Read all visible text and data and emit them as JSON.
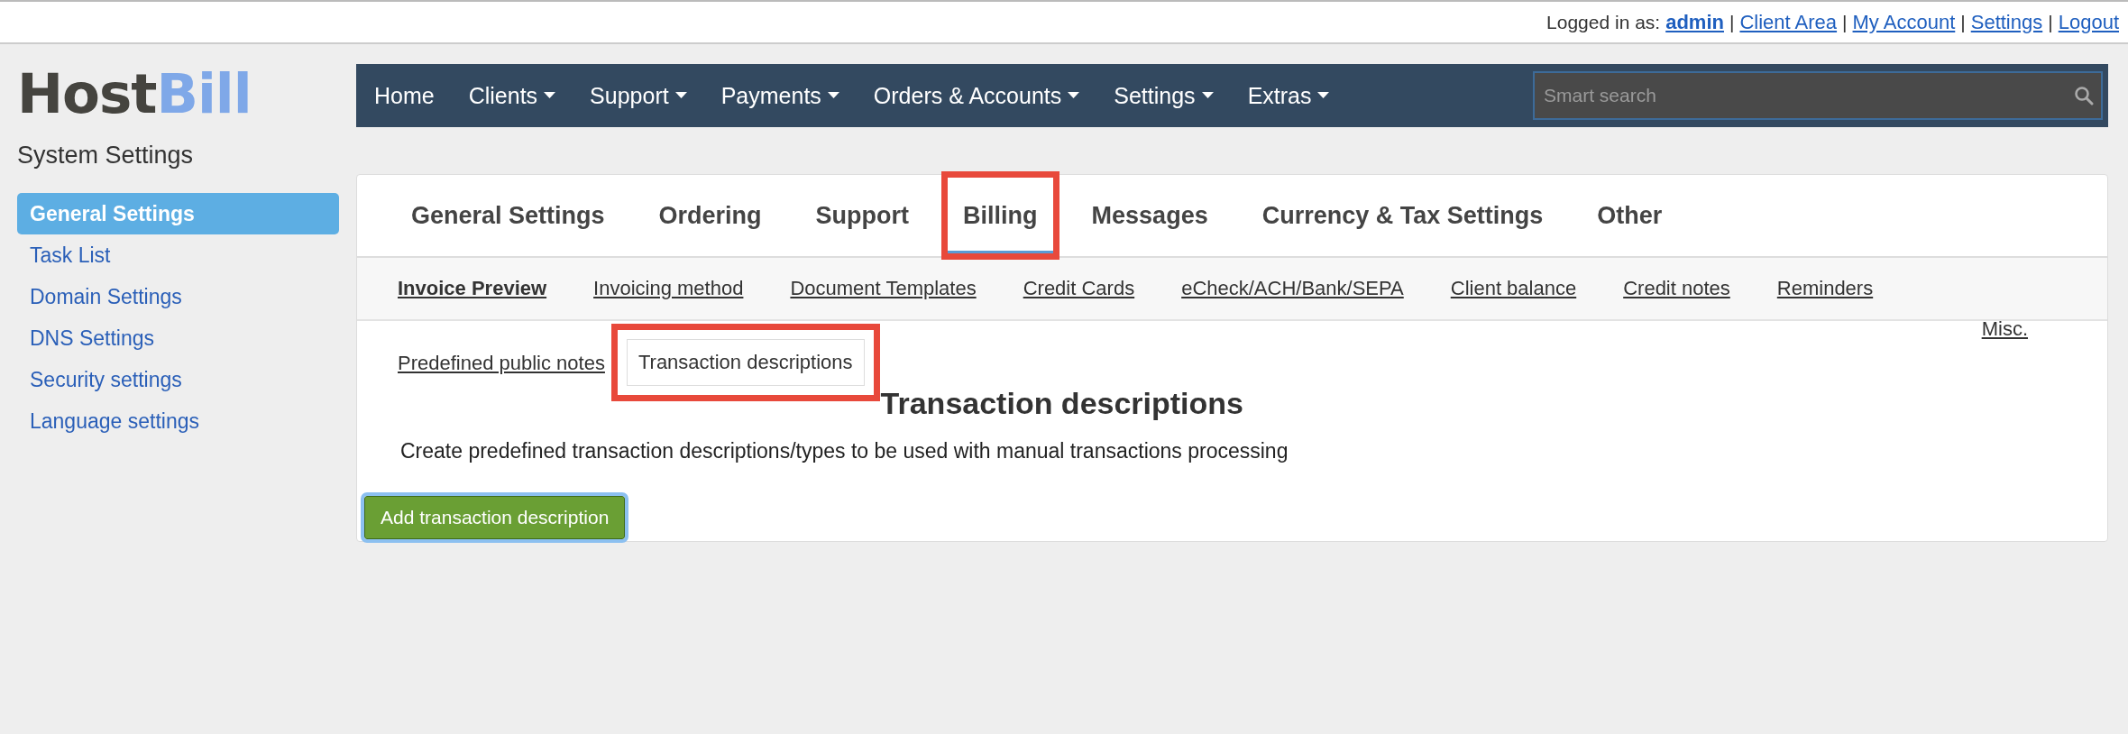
{
  "top_bar": {
    "logged_in_label": "Logged in as:",
    "user": "admin",
    "links": [
      {
        "separator": "|",
        "label": "Client Area"
      },
      {
        "separator": "|",
        "label": "My Account"
      },
      {
        "separator": "|",
        "label": "Settings"
      },
      {
        "separator": "|",
        "label": "Logout"
      }
    ]
  },
  "logo": {
    "part_1": "Host",
    "part_2": "Bill"
  },
  "sidebar": {
    "title": "System Settings",
    "items": [
      {
        "label": "General Settings",
        "selected": true
      },
      {
        "label": "Task List",
        "selected": false
      },
      {
        "label": "Domain Settings",
        "selected": false
      },
      {
        "label": "DNS Settings",
        "selected": false
      },
      {
        "label": "Security settings",
        "selected": false
      },
      {
        "label": "Language settings",
        "selected": false
      }
    ]
  },
  "nav": {
    "items": [
      {
        "label": "Home",
        "dropdown": false
      },
      {
        "label": "Clients",
        "dropdown": true
      },
      {
        "label": "Support",
        "dropdown": true
      },
      {
        "label": "Payments",
        "dropdown": true
      },
      {
        "label": "Orders & Accounts",
        "dropdown": true
      },
      {
        "label": "Settings",
        "dropdown": true
      },
      {
        "label": "Extras",
        "dropdown": true
      }
    ],
    "search": {
      "placeholder": "Smart search"
    }
  },
  "tabs": [
    {
      "label": "General Settings",
      "selected": false,
      "highlighted": false
    },
    {
      "label": "Ordering",
      "selected": false,
      "highlighted": false
    },
    {
      "label": "Support",
      "selected": false,
      "highlighted": false
    },
    {
      "label": "Billing",
      "selected": true,
      "highlighted": true
    },
    {
      "label": "Messages",
      "selected": false,
      "highlighted": false
    },
    {
      "label": "Currency & Tax Settings",
      "selected": false,
      "highlighted": false
    },
    {
      "label": "Other",
      "selected": false,
      "highlighted": false
    }
  ],
  "subtabs": [
    {
      "label": "Invoice Preview",
      "emphasized": true
    },
    {
      "label": "Invoicing method",
      "emphasized": false
    },
    {
      "label": "Document Templates",
      "emphasized": false
    },
    {
      "label": "Credit Cards",
      "emphasized": false
    },
    {
      "label": "eCheck/ACH/Bank/SEPA",
      "emphasized": false
    },
    {
      "label": "Client balance",
      "emphasized": false
    },
    {
      "label": "Credit notes",
      "emphasized": false
    },
    {
      "label": "Reminders",
      "emphasized": false
    }
  ],
  "misc_link": "Misc.",
  "section_tabs": [
    {
      "label": "Predefined public notes",
      "selected": false,
      "highlighted": false
    },
    {
      "label": "Transaction descriptions",
      "selected": true,
      "highlighted": true
    }
  ],
  "section": {
    "title": "Transaction descriptions",
    "description": "Create predefined transaction descriptions/types to be used with manual transactions processing",
    "button": "Add transaction description"
  }
}
